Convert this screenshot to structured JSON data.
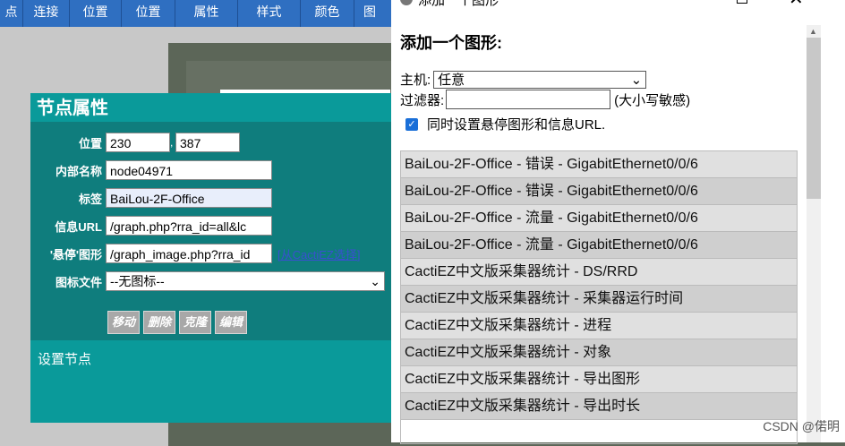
{
  "toolbar": {
    "items": [
      "点",
      "连接",
      "位置",
      "位置",
      "属性",
      "样式",
      "颜色",
      "图"
    ]
  },
  "node_panel": {
    "title": "节点属性",
    "position_label": "位置",
    "pos_x": "230",
    "pos_sep": ",",
    "pos_y": "387",
    "internal_name_label": "内部名称",
    "internal_name": "node04971",
    "tag_label": "标签",
    "tag": "BaiLou-2F-Office",
    "info_url_label": "信息URL",
    "info_url": "/graph.php?rra_id=all&lc",
    "hover_label": "'悬停'图形",
    "hover_url": "/graph_image.php?rra_id",
    "cactiez_link": "[从CactiEZ选择]",
    "icon_label": "图标文件",
    "icon_value": "--无图标--",
    "buttons": [
      "移动",
      "删除",
      "克隆",
      "编辑"
    ],
    "footer": "设置节点"
  },
  "dialog": {
    "title": "添加一个图形",
    "heading": "添加一个图形:",
    "host_label": "主机:",
    "host_value": "任意",
    "filter_label": "过滤器:",
    "filter_value": "",
    "case_hint": "(大小写敏感)",
    "checkbox_label": "同时设置悬停图形和信息URL.",
    "checkbox_checked": true,
    "list": [
      "BaiLou-2F-Office - 错误 - GigabitEthernet0/0/6",
      "BaiLou-2F-Office - 错误 - GigabitEthernet0/0/6",
      "BaiLou-2F-Office - 流量 - GigabitEthernet0/0/6",
      "BaiLou-2F-Office - 流量 - GigabitEthernet0/0/6",
      "CactiEZ中文版采集器统计 - DS/RRD",
      "CactiEZ中文版采集器统计 - 采集器运行时间",
      "CactiEZ中文版采集器统计 - 进程",
      "CactiEZ中文版采集器统计 - 对象",
      "CactiEZ中文版采集器统计 - 导出图形",
      "CactiEZ中文版采集器统计 - 导出时长"
    ]
  },
  "watermark": "CSDN @偌明"
}
